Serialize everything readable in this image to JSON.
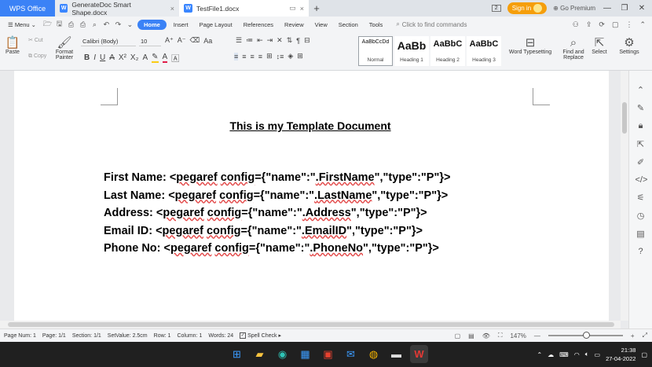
{
  "titlebar": {
    "app_tab": "WPS Office",
    "tabs": [
      {
        "label": "GenerateDoc Smart Shape.docx"
      },
      {
        "label": "TestFile1.docx"
      }
    ],
    "signin_label": "Sign in",
    "go_premium_label": "Go Premium",
    "page_counter": "2"
  },
  "menu": {
    "menu_label": "Menu",
    "tabs": [
      "Home",
      "Insert",
      "Page Layout",
      "References",
      "Review",
      "View",
      "Section",
      "Tools"
    ],
    "search_placeholder": "Click to find commands"
  },
  "ribbon": {
    "paste": "Paste",
    "cut": "Cut",
    "copy": "Copy",
    "format_painter": "Format Painter",
    "font_name": "Calibri (Body)",
    "font_size": "10",
    "styles": [
      {
        "sample": "AaBbCcDd",
        "label": "Normal"
      },
      {
        "sample": "AaBb",
        "label": "Heading 1"
      },
      {
        "sample": "AaBbC",
        "label": "Heading 2"
      },
      {
        "sample": "AaBbC",
        "label": "Heading 3"
      }
    ],
    "word_typesetting": "Word Typesetting",
    "find_replace": "Find and Replace",
    "select": "Select",
    "settings": "Settings"
  },
  "document": {
    "title": "This is my Template Document",
    "fields": [
      {
        "label": "First Name: ",
        "prefix": "<",
        "tag": "pegaref",
        "sp": " ",
        "cfg": "config",
        "mid": "={\"name\":\"",
        "dot": ".",
        "name": "FirstName",
        "tail": "\",\"type\":\"P\"}>"
      },
      {
        "label": "Last Name: ",
        "prefix": "<",
        "tag": "pegaref",
        "sp": " ",
        "cfg": "config",
        "mid": "={\"name\":\"",
        "dot": ".",
        "name": "LastName",
        "tail": "\",\"type\":\"P\"}>"
      },
      {
        "label": "Address: ",
        "prefix": "<",
        "tag": "pegaref",
        "sp": " ",
        "cfg": "config",
        "mid": "={\"name\":\"",
        "dot": ".",
        "name": "Address",
        "tail": "\",\"type\":\"P\"}>"
      },
      {
        "label": "Email ID: ",
        "prefix": "<",
        "tag": "pegaref",
        "sp": " ",
        "cfg": "config",
        "mid": "={\"name\":\"",
        "dot": ".",
        "name": "EmailID",
        "tail": "\",\"type\":\"P\"}>"
      },
      {
        "label": "Phone No: ",
        "prefix": "<",
        "tag": "pegaref",
        "sp": " ",
        "cfg": "config",
        "mid": "={\"name\":\"",
        "dot": ".",
        "name": "PhoneNo",
        "tail": "\",\"type\":\"P\"}>"
      }
    ]
  },
  "status": {
    "page_num": "Page Num: 1",
    "page": "Page: 1/1",
    "section": "Section: 1/1",
    "set_value": "SetValue: 2.5cm",
    "row": "Row: 1",
    "column": "Column: 1",
    "words": "Words: 24",
    "spell_check": "Spell Check",
    "zoom": "147%"
  },
  "taskbar": {
    "time": "21:38",
    "date": "27-04-2022"
  }
}
